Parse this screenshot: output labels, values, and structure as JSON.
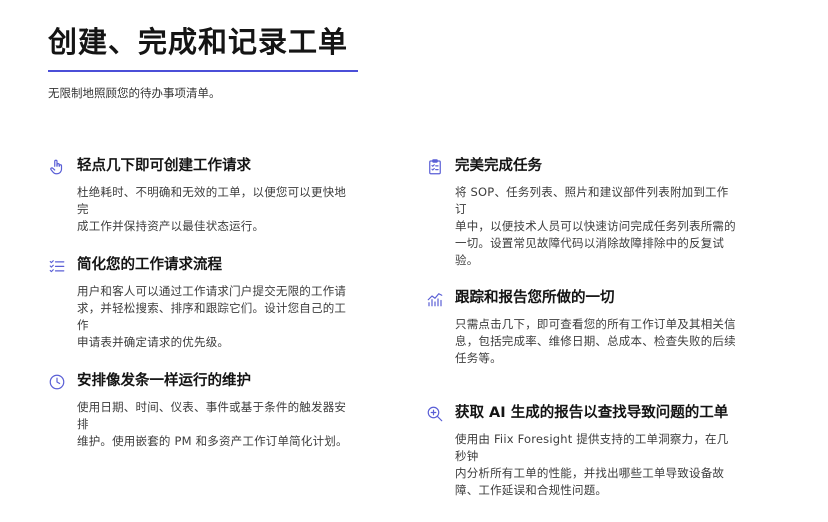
{
  "header": {
    "title": "创建、完成和记录工单",
    "subtitle": "无限制地照顾您的待办事项清单。"
  },
  "colors": {
    "accent": "#4b4fd8",
    "icon": "#5a5fd6",
    "heading": "#141414",
    "body_text": "#3c3c3c"
  },
  "features": [
    {
      "icon": "hand-pointer-icon",
      "title": "轻点几下即可创建工作请求",
      "lines": [
        "杜绝耗时、不明确和无效的工单，以便您可以更快地完",
        "成工作并保持资产以最佳状态运行。"
      ]
    },
    {
      "icon": "checklist-icon",
      "title": "简化您的工作请求流程",
      "lines": [
        "用户和客人可以通过工作请求门户提交无限的工作请",
        "求，并轻松搜索、排序和跟踪它们。设计您自己的工作",
        "申请表并确定请求的优先级。"
      ]
    },
    {
      "icon": "clock-icon",
      "title": "安排像发条一样运行的维护",
      "lines": [
        "使用日期、时间、仪表、事件或基于条件的触发器安排",
        "维护。使用嵌套的 PM 和多资产工作订单简化计划。"
      ]
    },
    {
      "icon": "clipboard-checklist-icon",
      "title": "完美完成任务",
      "lines": [
        "将 SOP、任务列表、照片和建议部件列表附加到工作订",
        "单中，以便技术人员可以快速访问完成任务列表所需的",
        "一切。设置常见故障代码以消除故障排除中的反复试",
        "验。"
      ]
    },
    {
      "icon": "chart-trend-icon",
      "title": "跟踪和报告您所做的一切",
      "lines": [
        "只需点击几下，即可查看您的所有工作订单及其相关信",
        "息，包括完成率、维修日期、总成本、检查失败的后续",
        "任务等。"
      ]
    },
    {
      "icon": "magnify-plus-icon",
      "title": "获取 AI 生成的报告以查找导致问题的工单",
      "lines": [
        "使用由 Fiix Foresight 提供支持的工单洞察力，在几秒钟",
        "内分析所有工单的性能，并找出哪些工单导致设备故",
        "障、工作延误和合规性问题。"
      ]
    }
  ]
}
